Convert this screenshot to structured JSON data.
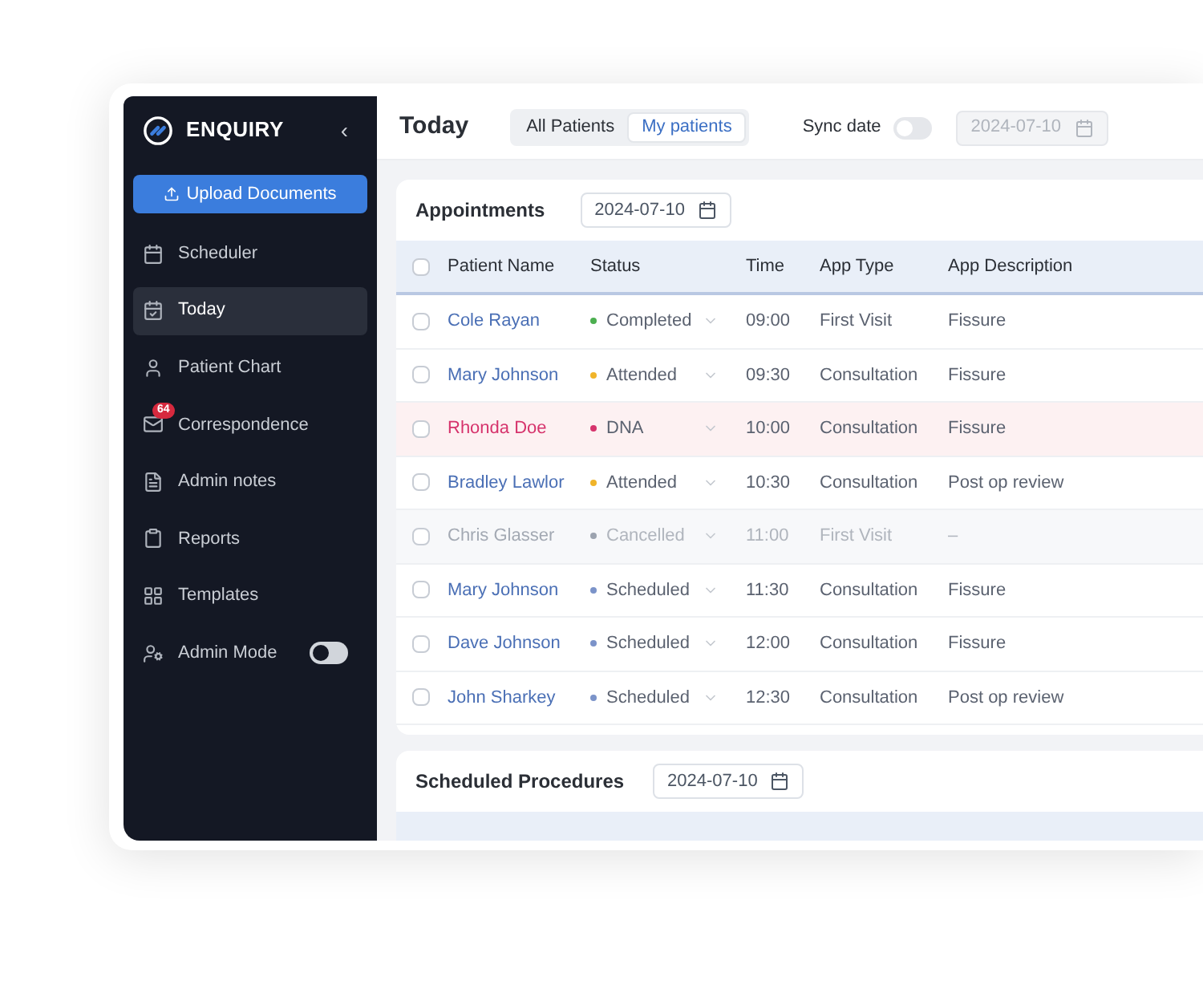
{
  "sidebar": {
    "brand": "ENQUIRY",
    "collapse": "‹",
    "upload_button": "Upload Documents",
    "items": [
      {
        "label": "Scheduler",
        "selected": false
      },
      {
        "label": "Today",
        "selected": true
      },
      {
        "label": "Patient Chart",
        "selected": false
      },
      {
        "label": "Correspondence",
        "selected": false,
        "badge": "64"
      },
      {
        "label": "Admin notes",
        "selected": false
      },
      {
        "label": "Reports",
        "selected": false
      },
      {
        "label": "Templates",
        "selected": false
      },
      {
        "label": "Admin Mode",
        "selected": false,
        "kind": "toggle",
        "on": false
      }
    ]
  },
  "header": {
    "title": "Today",
    "tabs": [
      {
        "label": "All Patients",
        "selected": false
      },
      {
        "label": "My patients",
        "selected": true
      }
    ],
    "sync_label": "Sync date",
    "sync_on": false,
    "date": "2024-07-10",
    "date_disabled": true
  },
  "appointments": {
    "title": "Appointments",
    "date": "2024-07-10",
    "columns": [
      "Patient Name",
      "Status",
      "Time",
      "App Type",
      "App Description"
    ],
    "select_all_checked": false,
    "rows": [
      {
        "name": "Cole Rayan",
        "status": "Completed",
        "color": "#4caf50",
        "time": "09:00",
        "type": "First Visit",
        "description": "Fissure",
        "kind": "normal",
        "checked": false
      },
      {
        "name": "Mary Johnson",
        "status": "Attended",
        "color": "#f0b429",
        "time": "09:30",
        "type": "Consultation",
        "description": "Fissure",
        "kind": "normal",
        "checked": false
      },
      {
        "name": "Rhonda Doe",
        "status": "DNA",
        "color": "#d6336c",
        "time": "10:00",
        "type": "Consultation",
        "description": "Fissure",
        "kind": "missed",
        "checked": false
      },
      {
        "name": "Bradley Lawlor",
        "status": "Attended",
        "color": "#f0b429",
        "time": "10:30",
        "type": "Consultation",
        "description": "Post op review",
        "kind": "normal",
        "checked": false
      },
      {
        "name": "Chris Glasser",
        "status": "Cancelled",
        "color": "#9ca3af",
        "time": "11:00",
        "type": "First Visit",
        "description": "–",
        "kind": "cancelled",
        "checked": false
      },
      {
        "name": "Mary Johnson",
        "status": "Scheduled",
        "color": "#7b93c9",
        "time": "11:30",
        "type": "Consultation",
        "description": "Fissure",
        "kind": "normal",
        "checked": false
      },
      {
        "name": "Dave Johnson",
        "status": "Scheduled",
        "color": "#7b93c9",
        "time": "12:00",
        "type": "Consultation",
        "description": "Fissure",
        "kind": "normal",
        "checked": false
      },
      {
        "name": "John Sharkey",
        "status": "Scheduled",
        "color": "#7b93c9",
        "time": "12:30",
        "type": "Consultation",
        "description": "Post op review",
        "kind": "normal",
        "checked": false
      }
    ]
  },
  "procedures": {
    "title": "Scheduled Procedures",
    "date": "2024-07-10"
  }
}
